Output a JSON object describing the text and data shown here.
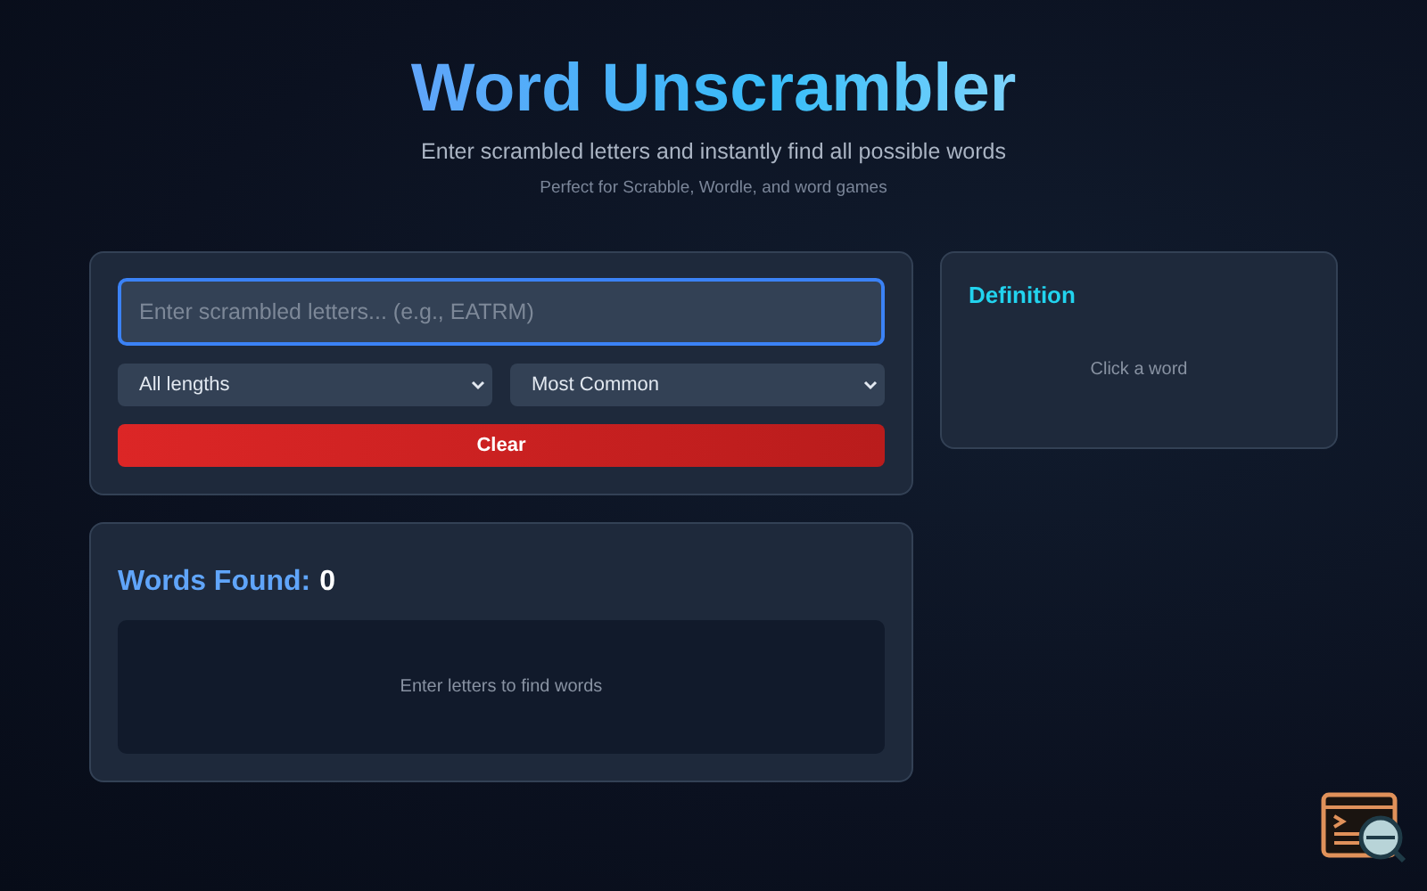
{
  "header": {
    "title": "Word Unscrambler",
    "subtitle": "Enter scrambled letters and instantly find all possible words",
    "tagline": "Perfect for Scrabble, Wordle, and word games"
  },
  "search": {
    "placeholder": "Enter scrambled letters... (e.g., EATRM)",
    "focused": true
  },
  "filters": [
    {
      "value": "All lengths"
    },
    {
      "value": "Most Common"
    }
  ],
  "clear_button": "Clear",
  "results": {
    "label": "Words Found:",
    "count": "0",
    "empty_message": "Enter letters to find words"
  },
  "definition": {
    "title": "Definition",
    "hint": "Click a word"
  }
}
